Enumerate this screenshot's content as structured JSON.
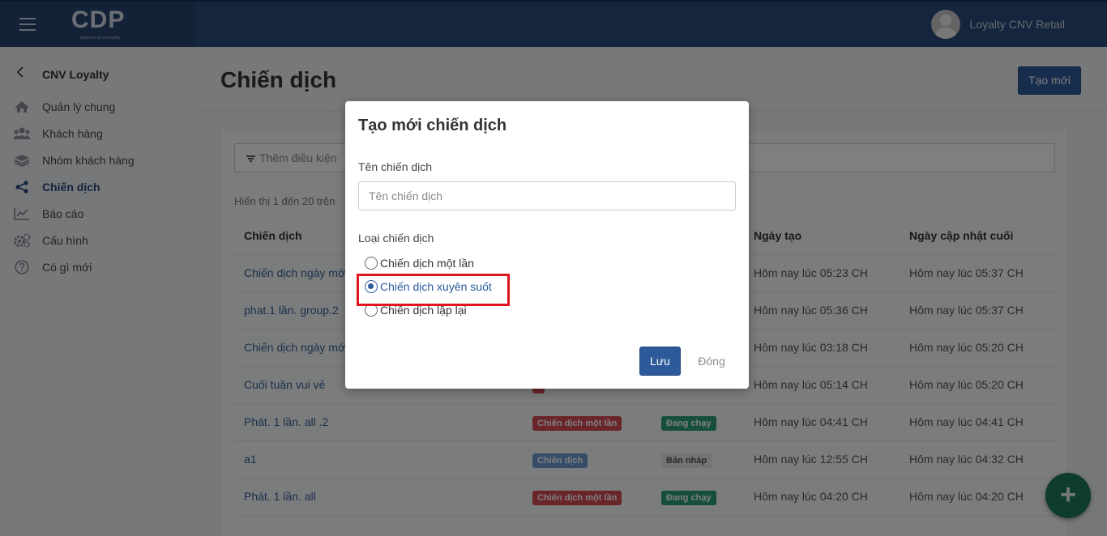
{
  "topbar": {
    "logo": "CDP",
    "logo_sub": "powered by cnvloyalty",
    "user_name": "Loyalty CNV Retail"
  },
  "sidebar": {
    "title": "CNV Loyalty",
    "items": [
      {
        "label": "Quản lý chung",
        "icon": "home-icon"
      },
      {
        "label": "Khách hàng",
        "icon": "users-icon"
      },
      {
        "label": "Nhóm khách hàng",
        "icon": "layers-icon"
      },
      {
        "label": "Chiến dịch",
        "icon": "share-icon",
        "active": true
      },
      {
        "label": "Báo cáo",
        "icon": "chart-icon"
      },
      {
        "label": "Cấu hình",
        "icon": "gears-icon"
      },
      {
        "label": "Có gì mới",
        "icon": "question-icon"
      }
    ]
  },
  "page": {
    "title": "Chiến dịch",
    "create_button": "Tạo mới"
  },
  "filter": {
    "placeholder": "Thêm điều kiện"
  },
  "table": {
    "summary": "Hiển thị 1 đến 20 trên",
    "headers": [
      "Chiến dịch",
      "Ngày tạo",
      "Ngày cập nhật cuối"
    ],
    "rows": [
      {
        "name": "Chiến dịch ngày mới",
        "type": "",
        "status": "",
        "created": "Hôm nay lúc 05:23 CH",
        "updated": "Hôm nay lúc 05:37 CH"
      },
      {
        "name": "phat.1 lần. group.2",
        "type": "",
        "status": "",
        "created": "Hôm nay lúc 05:36 CH",
        "updated": "Hôm nay lúc 05:37 CH"
      },
      {
        "name": "Chiến dịch ngày mới",
        "type": "",
        "status": "",
        "created": "Hôm nay lúc 03:18 CH",
        "updated": "Hôm nay lúc 05:20 CH"
      },
      {
        "name": "Cuối tuần vui vẻ",
        "type": "",
        "status": "",
        "created": "Hôm nay lúc 05:14 CH",
        "updated": "Hôm nay lúc 05:20 CH"
      },
      {
        "name": "Phát. 1 lần. all .2",
        "type": "Chiến dịch một lần",
        "status": "Đang chạy",
        "created": "Hôm nay lúc 04:41 CH",
        "updated": "Hôm nay lúc 04:41 CH"
      },
      {
        "name": "a1",
        "type": "Chiến dịch",
        "status": "Bản nháp",
        "created": "Hôm nay lúc 12:55 CH",
        "updated": "Hôm nay lúc 04:32 CH"
      },
      {
        "name": "Phát. 1 lần. all",
        "type": "Chiến dịch một lần",
        "status": "Đang chạy",
        "created": "Hôm nay lúc 04:20 CH",
        "updated": "Hôm nay lúc 04:20 CH"
      }
    ]
  },
  "modal": {
    "title": "Tạo mới chiến dịch",
    "name_label": "Tên chiến dịch",
    "name_placeholder": "Tên chiến dịch",
    "name_value": "",
    "type_label": "Loại chiến dịch",
    "options": [
      {
        "label": "Chiến dịch một lần",
        "checked": false
      },
      {
        "label": "Chiến dịch xuyên suốt",
        "checked": true
      },
      {
        "label": "Chiến dịch lặp lại",
        "checked": false
      }
    ],
    "save_button": "Lưu",
    "close_button": "Đóng"
  },
  "fab": {
    "symbol": "+"
  },
  "colors": {
    "header": "#2b4a7b",
    "primary": "#2c5a9a",
    "highlight": "#e0141e",
    "running": "#2d9c7d",
    "type_badge": "#d54a52"
  }
}
